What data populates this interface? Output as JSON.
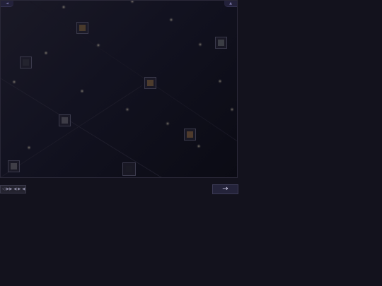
{
  "board": {
    "corner_left_label": "◄",
    "corner_right_label": "▲",
    "glows": [
      {
        "name": "glow-1"
      },
      {
        "name": "glow-2"
      },
      {
        "name": "glow-3"
      },
      {
        "name": "glow-4"
      },
      {
        "name": "glow-5"
      },
      {
        "name": "glow-6"
      },
      {
        "name": "glow-7"
      },
      {
        "name": "glow-8"
      },
      {
        "name": "glow-9"
      },
      {
        "name": "glow-10"
      },
      {
        "name": "glow-11"
      },
      {
        "name": "glow-12"
      },
      {
        "name": "glow-13"
      },
      {
        "name": "glow-14"
      }
    ],
    "tiles": [
      {
        "name": "tile-1",
        "color": "#4a3b2c"
      },
      {
        "name": "tile-2",
        "color": "#3b3d44"
      },
      {
        "name": "tile-3",
        "color": "#23232e"
      },
      {
        "name": "tile-4",
        "color": "#4d3c2d"
      },
      {
        "name": "tile-5",
        "color": "#3d3c46"
      },
      {
        "name": "tile-6",
        "color": "#4f3b2c"
      },
      {
        "name": "tile-7",
        "color": "#3f3e47"
      },
      {
        "name": "tile-8",
        "color": "#1a1a24"
      }
    ]
  },
  "controls": {
    "input_label": "◁ ▶▶ ◀ ▶ ◀ ▶ ■",
    "next_label": "→"
  },
  "colors": {
    "background": "#13121d",
    "board_frame": "#2a2838",
    "accent": "#7a76a8"
  }
}
